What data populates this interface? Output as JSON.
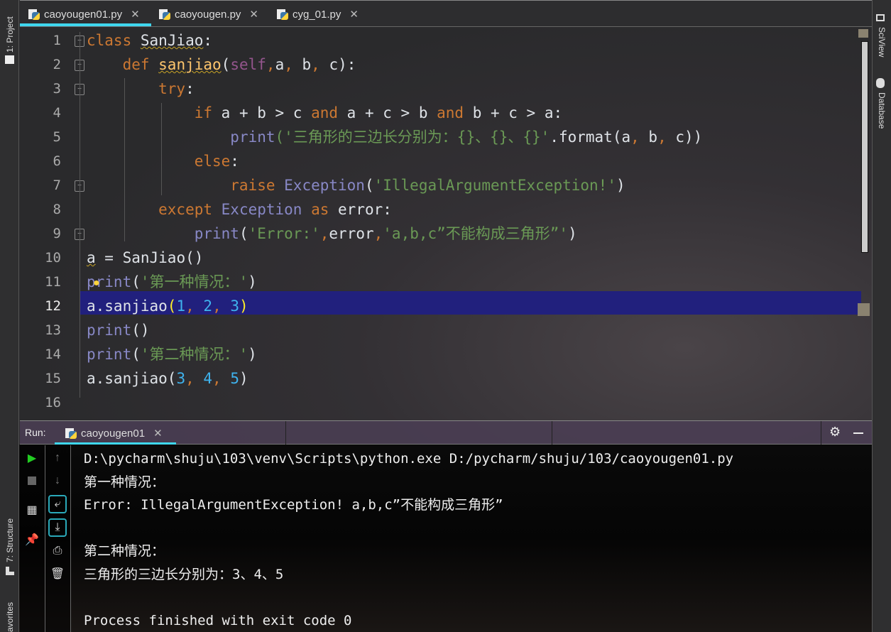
{
  "left_sidebar": {
    "project": "1: Project",
    "structure": "7: Structure",
    "favorites": "avorites"
  },
  "right_sidebar": {
    "sciview": "SciView",
    "database": "Database"
  },
  "tabs": [
    {
      "label": "caoyougen01.py",
      "active": true
    },
    {
      "label": "caoyougen.py",
      "active": false
    },
    {
      "label": "cyg_01.py",
      "active": false
    }
  ],
  "close_glyph": "✕",
  "editor": {
    "line_numbers": [
      "1",
      "2",
      "3",
      "4",
      "5",
      "6",
      "7",
      "8",
      "9",
      "10",
      "11",
      "12",
      "13",
      "14",
      "15",
      "16"
    ],
    "current_line": 12,
    "lines": [
      [
        [
          "class ",
          "kw"
        ],
        [
          "SanJiao",
          "warn"
        ],
        [
          ":",
          ""
        ]
      ],
      [
        [
          "    def ",
          "kw"
        ],
        [
          "sanjiao",
          "fn"
        ],
        [
          "(",
          ""
        ],
        [
          "self",
          "self"
        ],
        [
          ",",
          "pn"
        ],
        [
          "a",
          ""
        ],
        [
          ", ",
          "pn"
        ],
        [
          "b",
          ""
        ],
        [
          ", ",
          "pn"
        ],
        [
          "c",
          ""
        ],
        [
          "):",
          ""
        ]
      ],
      [
        [
          "        try",
          "kw"
        ],
        [
          ":",
          ""
        ]
      ],
      [
        [
          "            if ",
          "kw"
        ],
        [
          "a + b > c ",
          ""
        ],
        [
          "and ",
          "kw"
        ],
        [
          "a + c > b ",
          ""
        ],
        [
          "and ",
          "kw"
        ],
        [
          "b + c > a:",
          ""
        ]
      ],
      [
        [
          "                ",
          ""
        ],
        [
          "print",
          "bi"
        ],
        [
          "('三角形的三边长分别为：{}、{}、{}'",
          "str"
        ],
        [
          ".format(a",
          ""
        ],
        [
          ", ",
          "pn"
        ],
        [
          "b",
          ""
        ],
        [
          ", ",
          "pn"
        ],
        [
          "c))",
          ""
        ]
      ],
      [
        [
          "            else",
          "kw"
        ],
        [
          ":",
          ""
        ]
      ],
      [
        [
          "                raise ",
          "kw"
        ],
        [
          "Exception",
          "bi"
        ],
        [
          "(",
          ""
        ],
        [
          "'IllegalArgumentException!'",
          "str"
        ],
        [
          ")",
          ""
        ]
      ],
      [
        [
          "        except ",
          "kw"
        ],
        [
          "Exception ",
          "bi"
        ],
        [
          "as ",
          "kw"
        ],
        [
          "error:",
          ""
        ]
      ],
      [
        [
          "            ",
          ""
        ],
        [
          "print",
          "bi"
        ],
        [
          "(",
          ""
        ],
        [
          "'Error:'",
          "str"
        ],
        [
          ",",
          "pn"
        ],
        [
          "error",
          ""
        ],
        [
          ",",
          "pn"
        ],
        [
          "'a,b,c”不能构成三角形”'",
          "str"
        ],
        [
          ")",
          ""
        ]
      ],
      [
        [
          "a",
          "warn"
        ],
        [
          " = SanJiao()",
          ""
        ]
      ],
      [
        [
          "print",
          "bi"
        ],
        [
          "(",
          ""
        ],
        [
          "'第一种情况：'",
          "str"
        ],
        [
          ")",
          ""
        ]
      ],
      [
        [
          "a.sanjiao",
          ""
        ],
        [
          "(",
          "bp"
        ],
        [
          "1",
          "num"
        ],
        [
          ", ",
          "pn"
        ],
        [
          "2",
          "num"
        ],
        [
          ", ",
          "pn"
        ],
        [
          "3",
          "num"
        ],
        [
          ")",
          "bp"
        ]
      ],
      [
        [
          "print",
          "bi"
        ],
        [
          "()",
          ""
        ]
      ],
      [
        [
          "print",
          "bi"
        ],
        [
          "(",
          ""
        ],
        [
          "'第二种情况：'",
          "str"
        ],
        [
          ")",
          ""
        ]
      ],
      [
        [
          "a.sanjiao(",
          ""
        ],
        [
          "3",
          "num"
        ],
        [
          ", ",
          "pn"
        ],
        [
          "4",
          "num"
        ],
        [
          ", ",
          "pn"
        ],
        [
          "5",
          "num"
        ],
        [
          ")",
          ""
        ]
      ],
      [
        [
          "",
          ""
        ]
      ]
    ]
  },
  "run_panel": {
    "label": "Run:",
    "tab": "caoyougen01",
    "output": [
      "D:\\pycharm\\shuju\\103\\venv\\Scripts\\python.exe D:/pycharm/shuju/103/caoyougen01.py",
      "第一种情况：",
      "Error: IllegalArgumentException! a,b,c”不能构成三角形”",
      "",
      "第二种情况：",
      "三角形的三边长分别为：3、4、5",
      "",
      "Process finished with exit code 0"
    ]
  },
  "colors": {
    "accent": "#3fd7ee",
    "current_line": "#21207d",
    "keyword": "#cc7832",
    "string": "#6a9955",
    "run": "#22cc22"
  }
}
